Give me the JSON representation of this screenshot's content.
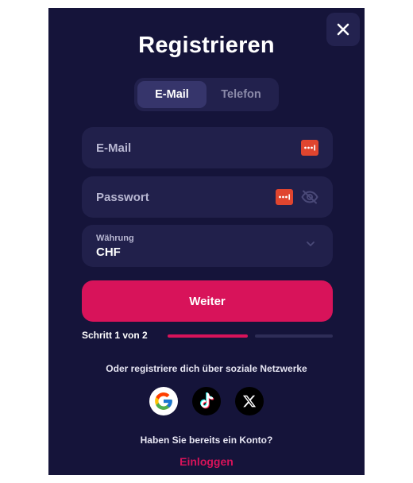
{
  "modal": {
    "title": "Registrieren"
  },
  "tabs": [
    {
      "label": "E-Mail",
      "active": true
    },
    {
      "label": "Telefon",
      "active": false
    }
  ],
  "form": {
    "email_label": "E-Mail",
    "password_label": "Passwort",
    "currency_label": "Währung",
    "currency_value": "CHF"
  },
  "actions": {
    "continue_label": "Weiter",
    "step_text": "Schritt 1 von 2"
  },
  "social": {
    "prompt": "Oder registriere dich über soziale Netzwerke",
    "providers": [
      "google-icon",
      "tiktok-icon",
      "x-icon"
    ]
  },
  "footer": {
    "question": "Haben Sie bereits ein Konto?",
    "login_label": "Einloggen"
  },
  "colors": {
    "background": "#15143a",
    "accent": "#d8135a",
    "field": "#21204b"
  }
}
